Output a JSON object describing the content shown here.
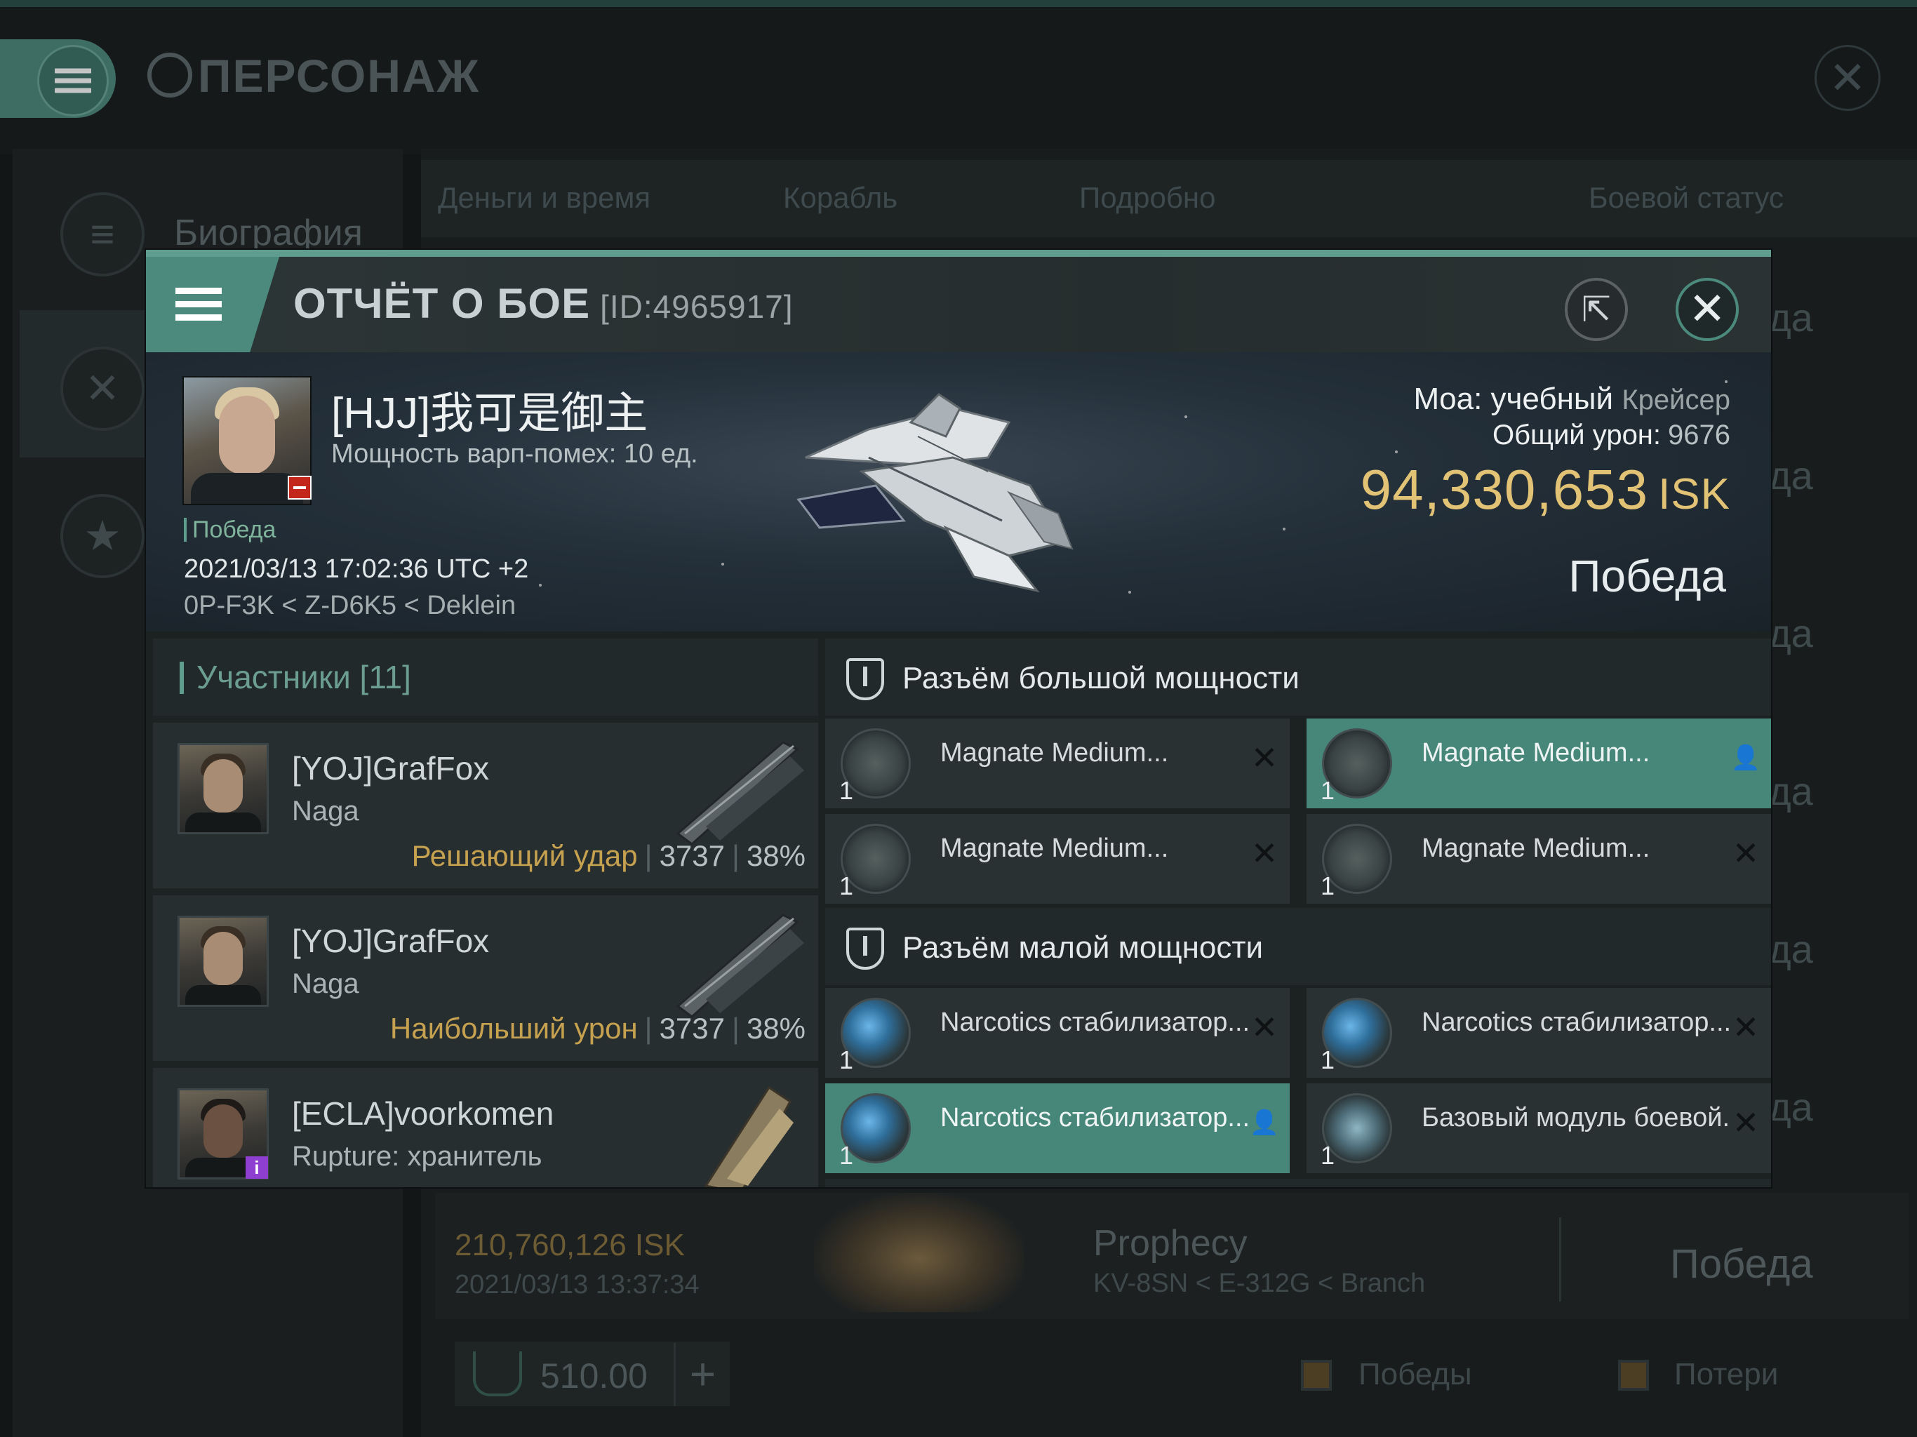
{
  "background": {
    "page_title": "ПЕРСОНАЖ",
    "sidebar": {
      "biography_label": "Биография"
    },
    "tabs": [
      "Деньги и время",
      "Корабль",
      "Подробно",
      "Боевой статус"
    ],
    "row_result_fragment": "да",
    "last_row": {
      "isk": "210,760,126  ISK",
      "datetime": "2021/03/13  13:37:34",
      "ship": "Prophecy",
      "location": "KV-8SN < E-312G < Branch",
      "result": "Победа"
    },
    "bottom_bar": {
      "value": "510.00",
      "plus_label": "+"
    },
    "legend": {
      "wins_label": "Победы",
      "losses_label": "Потери"
    }
  },
  "modal": {
    "title": "ОТЧЁТ О БОЕ",
    "id_text": "[ID:4965917]",
    "victim": {
      "name": "[HJJ]我可是御主",
      "warp_strength": "Мощность варп-помех: 10 ед.",
      "status": "Победа",
      "datetime": "2021/03/13 17:02:36 UTC +2",
      "location": "0P-F3K < Z-D6K5 < Deklein"
    },
    "ship": {
      "name": "Moa: учебный",
      "class": "Крейсер",
      "damage_label": "Общий урон:",
      "damage_value": "9676",
      "isk_value": "94,330,653",
      "isk_unit": "ISK",
      "result": "Победа"
    },
    "participants": {
      "header": "Участники [11]",
      "rows": [
        {
          "name": "[YOJ]GrafFox",
          "ship": "Naga",
          "role": "Решающий удар",
          "damage": "3737",
          "percent": "38%"
        },
        {
          "name": "[YOJ]GrafFox",
          "ship": "Naga",
          "role": "Наибольший урон",
          "damage": "3737",
          "percent": "38%"
        },
        {
          "name": "[ECLA]voorkomen",
          "ship": "Rupture: хранитель",
          "badge": "i"
        }
      ]
    },
    "slots": {
      "high_title": "Разъём большой мощности",
      "low_title": "Разъём малой мощности",
      "high": [
        {
          "name": "Magnate Medium...",
          "qty": "1",
          "action": "x",
          "highlighted": false
        },
        {
          "name": "Magnate Medium...",
          "qty": "1",
          "action": "person",
          "highlighted": true
        },
        {
          "name": "Magnate Medium...",
          "qty": "1",
          "action": "x",
          "highlighted": false
        },
        {
          "name": "Magnate Medium...",
          "qty": "1",
          "action": "x",
          "highlighted": false
        }
      ],
      "low": [
        {
          "name": "Narcotics стабилизатор...",
          "qty": "1",
          "action": "x",
          "highlighted": false
        },
        {
          "name": "Narcotics стабилизатор...",
          "qty": "1",
          "action": "x",
          "highlighted": false
        },
        {
          "name": "Narcotics стабилизатор...",
          "qty": "1",
          "action": "person",
          "highlighted": true
        },
        {
          "name": "Базовый модуль боевой...",
          "qty": "1",
          "action": "x",
          "highlighted": false
        }
      ]
    }
  },
  "colors": {
    "accent": "#4b8a7c",
    "isk_gold": "#e2c274",
    "role_gold": "#c6a14f",
    "danger": "#c3271c",
    "badge_purple": "#8e3fd0"
  },
  "icons": [
    "menu-icon",
    "emblem-icon",
    "close-icon",
    "share-icon",
    "star-icon",
    "swords-icon",
    "turret-icon",
    "module-icon",
    "person-icon",
    "slot-icon"
  ]
}
